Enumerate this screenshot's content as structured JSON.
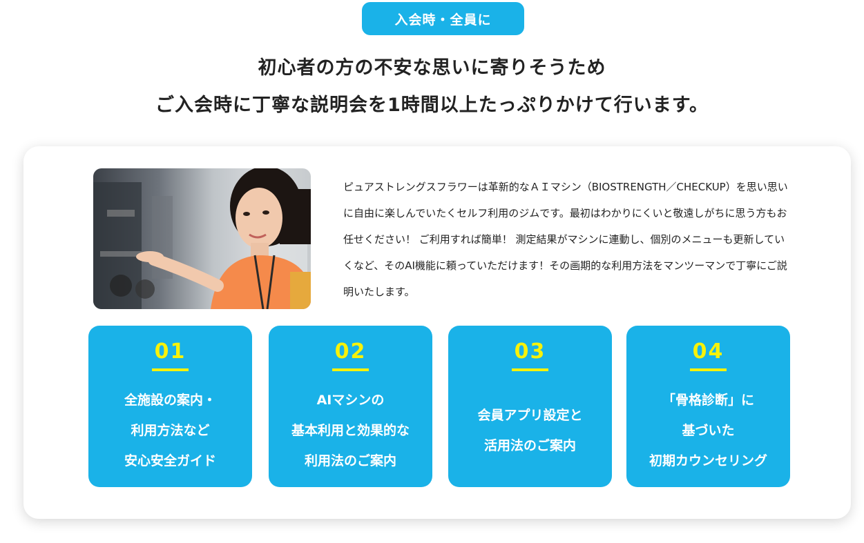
{
  "badge": "入会時・全員に",
  "headline": {
    "line1": "初心者の方の不安な思いに寄りそうため",
    "line2": "ご入会時に丁寧な説明会を1時間以上たっぷりかけて行います。"
  },
  "description": "ピュアストレングスフラワーは革新的なＡＩマシン（BIOSTRENGTH／CHECKUP）を思い思いに自由に楽しんでいたくセルフ利用のジムです。最初はわかりにくいと敬遠しがちに思う方もお任せください！ ご利用すれば簡単！ 測定結果がマシンに連動し、個別のメニューも更新していくなど、そのAI機能に頼っていただけます！その画期的な利用方法をマンツーマンで丁寧にご説明いたします。",
  "colors": {
    "accent": "#1ab2e8",
    "number": "#f7f20a"
  },
  "features": [
    {
      "number": "01",
      "lines": [
        "全施設の案内・",
        "利用方法など",
        "安心安全ガイド"
      ]
    },
    {
      "number": "02",
      "lines": [
        "AIマシンの",
        "基本利用と効果的な",
        "利用法のご案内"
      ]
    },
    {
      "number": "03",
      "lines": [
        "会員アプリ設定と",
        "活用法のご案内"
      ]
    },
    {
      "number": "04",
      "lines": [
        "「骨格診断」に",
        "基づいた",
        "初期カウンセリング"
      ]
    }
  ]
}
